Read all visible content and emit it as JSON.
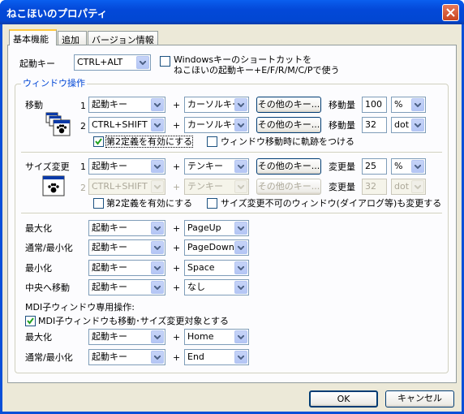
{
  "window": {
    "title": "ねこほいのプロパティ"
  },
  "tabs": [
    "基本機能",
    "追加",
    "バージョン情報"
  ],
  "launch": {
    "label": "起動キー",
    "value": "CTRL+ALT",
    "shortcut_line1": "Windowsキーのショートカットを",
    "shortcut_line2": "ねこほいの起動キー+E/F/R/M/C/Pで使う"
  },
  "window_ops": {
    "group_label": "ウィンドウ操作",
    "move": {
      "label": "移動",
      "row1": {
        "num": "1",
        "mod": "起動キー",
        "key": "カーソルキー",
        "other": "その他のキー...",
        "amount_label": "移動量",
        "amount": "100",
        "unit": "%"
      },
      "row2": {
        "num": "2",
        "mod": "CTRL+SHIFT",
        "key": "カーソルキー",
        "other": "その他のキー...",
        "amount_label": "移動量",
        "amount": "32",
        "unit": "dot"
      },
      "second": "第2定義を有効にする",
      "trail": "ウィンドウ移動時に軌跡をつける"
    },
    "resize": {
      "label": "サイズ変更",
      "row1": {
        "num": "1",
        "mod": "起動キー",
        "key": "テンキー",
        "other": "その他のキー...",
        "amount_label": "変更量",
        "amount": "25",
        "unit": "%"
      },
      "row2": {
        "num": "2",
        "mod": "CTRL+SHIFT",
        "key": "テンキー",
        "other": "その他のキー...",
        "amount_label": "変更量",
        "amount": "32",
        "unit": "dot"
      },
      "second": "第2定義を有効にする",
      "dialog": "サイズ変更不可のウィンドウ(ダイアログ等)も変更する"
    },
    "plus": "+",
    "actions": [
      {
        "label": "最大化",
        "mod": "起動キー",
        "key": "PageUp"
      },
      {
        "label": "通常/最小化",
        "mod": "起動キー",
        "key": "PageDown"
      },
      {
        "label": "最小化",
        "mod": "起動キー",
        "key": "Space"
      },
      {
        "label": "中央へ移動",
        "mod": "起動キー",
        "key": "なし"
      }
    ],
    "mdi_heading": "MDI子ウィンドウ専用操作:",
    "mdi_check": "MDI子ウィンドウも移動･サイズ変更対象とする",
    "mdi_actions": [
      {
        "label": "最大化",
        "mod": "起動キー",
        "key": "Home"
      },
      {
        "label": "通常/最小化",
        "mod": "起動キー",
        "key": "End"
      }
    ]
  },
  "buttons": {
    "ok": "OK",
    "cancel": "キャンセル"
  },
  "colors": {
    "titlebar": "#0348d8",
    "dialog_bg": "#ece9d8",
    "checkmark": "#21a121",
    "group_label": "#0046d5"
  }
}
